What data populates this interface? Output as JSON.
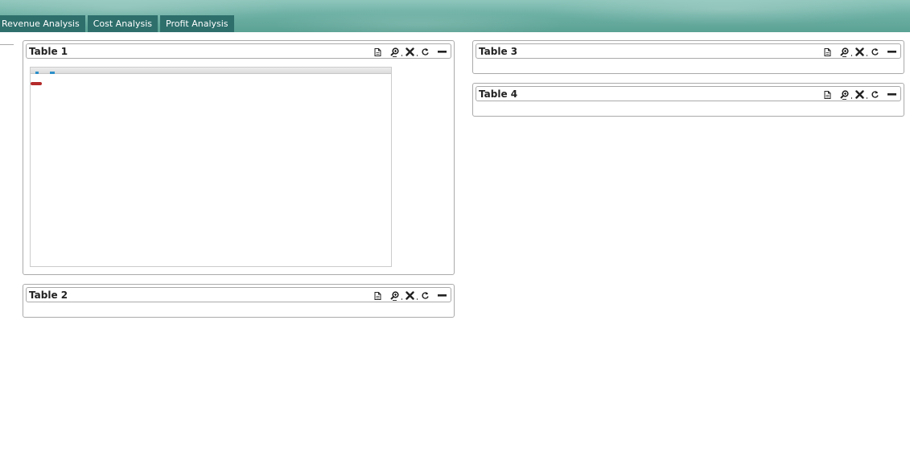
{
  "tabs": [
    {
      "label": "Revenue Analysis"
    },
    {
      "label": "Cost Analysis"
    },
    {
      "label": "Profit Analysis"
    }
  ],
  "panels": [
    {
      "title": "Table 1"
    },
    {
      "title": "Table 2"
    },
    {
      "title": "Table 3"
    },
    {
      "title": "Table 4"
    }
  ],
  "icons": {
    "export": "document-icon",
    "zoom": "zoom-icon",
    "close": "close-icon",
    "refresh": "refresh-icon",
    "collapse": "minimize-icon"
  },
  "colors": {
    "tab_bg": "#2e6f6c",
    "header_bg": "#6db0a4",
    "panel_border": "#aaaaaa",
    "marker": "#b42a2a"
  }
}
